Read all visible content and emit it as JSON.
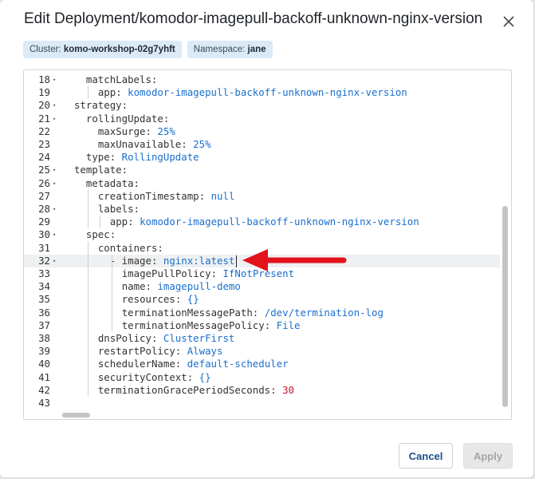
{
  "dialog": {
    "title": "Edit Deployment/komodor-imagepull-backoff-unknown-nginx-version",
    "cluster_label": "Cluster:",
    "cluster_value": "komo-workshop-02g7yhft",
    "namespace_label": "Namespace:",
    "namespace_value": "jane",
    "cancel_label": "Cancel",
    "apply_label": "Apply"
  },
  "editor": {
    "active_line": 32,
    "lines": [
      {
        "n": "18",
        "fold": true,
        "indent": 4,
        "key": "matchLabels:",
        "val": ""
      },
      {
        "n": "19",
        "fold": false,
        "indent": 6,
        "key": "app: ",
        "val": "komodor-imagepull-backoff-unknown-nginx-version"
      },
      {
        "n": "20",
        "fold": true,
        "indent": 2,
        "key": "strategy:",
        "val": ""
      },
      {
        "n": "21",
        "fold": true,
        "indent": 4,
        "key": "rollingUpdate:",
        "val": ""
      },
      {
        "n": "22",
        "fold": false,
        "indent": 6,
        "key": "maxSurge: ",
        "val": "25%"
      },
      {
        "n": "23",
        "fold": false,
        "indent": 6,
        "key": "maxUnavailable: ",
        "val": "25%"
      },
      {
        "n": "24",
        "fold": false,
        "indent": 4,
        "key": "type: ",
        "val": "RollingUpdate"
      },
      {
        "n": "25",
        "fold": true,
        "indent": 2,
        "key": "template:",
        "val": ""
      },
      {
        "n": "26",
        "fold": true,
        "indent": 4,
        "key": "metadata:",
        "val": ""
      },
      {
        "n": "27",
        "fold": false,
        "indent": 6,
        "key": "creationTimestamp: ",
        "val": "null"
      },
      {
        "n": "28",
        "fold": true,
        "indent": 6,
        "key": "labels:",
        "val": ""
      },
      {
        "n": "29",
        "fold": false,
        "indent": 8,
        "key": "app: ",
        "val": "komodor-imagepull-backoff-unknown-nginx-version"
      },
      {
        "n": "30",
        "fold": true,
        "indent": 4,
        "key": "spec:",
        "val": ""
      },
      {
        "n": "31",
        "fold": false,
        "indent": 6,
        "key": "containers:",
        "val": ""
      },
      {
        "n": "32",
        "fold": true,
        "indent": 8,
        "key": "- image: ",
        "val": "nginx:latest"
      },
      {
        "n": "33",
        "fold": false,
        "indent": 10,
        "key": "imagePullPolicy: ",
        "val": "IfNotPresent"
      },
      {
        "n": "34",
        "fold": false,
        "indent": 10,
        "key": "name: ",
        "val": "imagepull-demo"
      },
      {
        "n": "35",
        "fold": false,
        "indent": 10,
        "key": "resources: ",
        "val": "{}"
      },
      {
        "n": "36",
        "fold": false,
        "indent": 10,
        "key": "terminationMessagePath: ",
        "val": "/dev/termination-log"
      },
      {
        "n": "37",
        "fold": false,
        "indent": 10,
        "key": "terminationMessagePolicy: ",
        "val": "File"
      },
      {
        "n": "38",
        "fold": false,
        "indent": 6,
        "key": "dnsPolicy: ",
        "val": "ClusterFirst"
      },
      {
        "n": "39",
        "fold": false,
        "indent": 6,
        "key": "restartPolicy: ",
        "val": "Always"
      },
      {
        "n": "40",
        "fold": false,
        "indent": 6,
        "key": "schedulerName: ",
        "val": "default-scheduler"
      },
      {
        "n": "41",
        "fold": false,
        "indent": 6,
        "key": "securityContext: ",
        "val": "{}"
      },
      {
        "n": "42",
        "fold": false,
        "indent": 6,
        "key": "terminationGracePeriodSeconds: ",
        "val": "30",
        "numeric": true
      },
      {
        "n": "43",
        "fold": false,
        "indent": 0,
        "key": "",
        "val": ""
      }
    ]
  },
  "icons": {
    "close": "close-icon",
    "fold": "chevron-down-icon",
    "annotation": "red-arrow-icon"
  },
  "colors": {
    "value": "#1a6fcc",
    "number": "#c4162a",
    "annotation_arrow": "#e3121b",
    "badge_bg": "#dbeaf7",
    "button_primary_text": "#1b4f88"
  }
}
